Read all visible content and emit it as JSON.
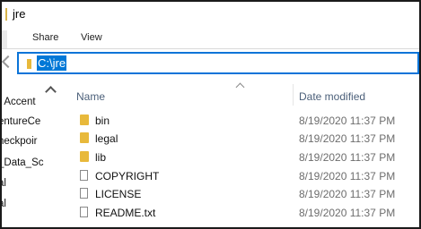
{
  "window": {
    "title": "jre"
  },
  "ribbon": {
    "tabs": [
      "Share",
      "View"
    ]
  },
  "address": {
    "path": "C:\\jre"
  },
  "nav": {
    "items": [
      "- Accent",
      "entureCe",
      "heckpoir",
      "_Data_Sc",
      "al",
      "al"
    ]
  },
  "columns": {
    "name": "Name",
    "date_modified": "Date modified"
  },
  "files": [
    {
      "name": "bin",
      "date": "8/19/2020 11:37 PM",
      "type": "folder",
      "icon": "folder-icon"
    },
    {
      "name": "legal",
      "date": "8/19/2020 11:37 PM",
      "type": "folder",
      "icon": "folder-icon"
    },
    {
      "name": "lib",
      "date": "8/19/2020 11:37 PM",
      "type": "folder",
      "icon": "folder-icon"
    },
    {
      "name": "COPYRIGHT",
      "date": "8/19/2020 11:37 PM",
      "type": "file",
      "icon": "file-icon"
    },
    {
      "name": "LICENSE",
      "date": "8/19/2020 11:37 PM",
      "type": "file",
      "icon": "file-icon"
    },
    {
      "name": "README.txt",
      "date": "8/19/2020 11:37 PM",
      "type": "file",
      "icon": "file-icon"
    }
  ],
  "colors": {
    "accent": "#0078d7",
    "folder": "#e8b93b",
    "header_text": "#4c607a"
  }
}
